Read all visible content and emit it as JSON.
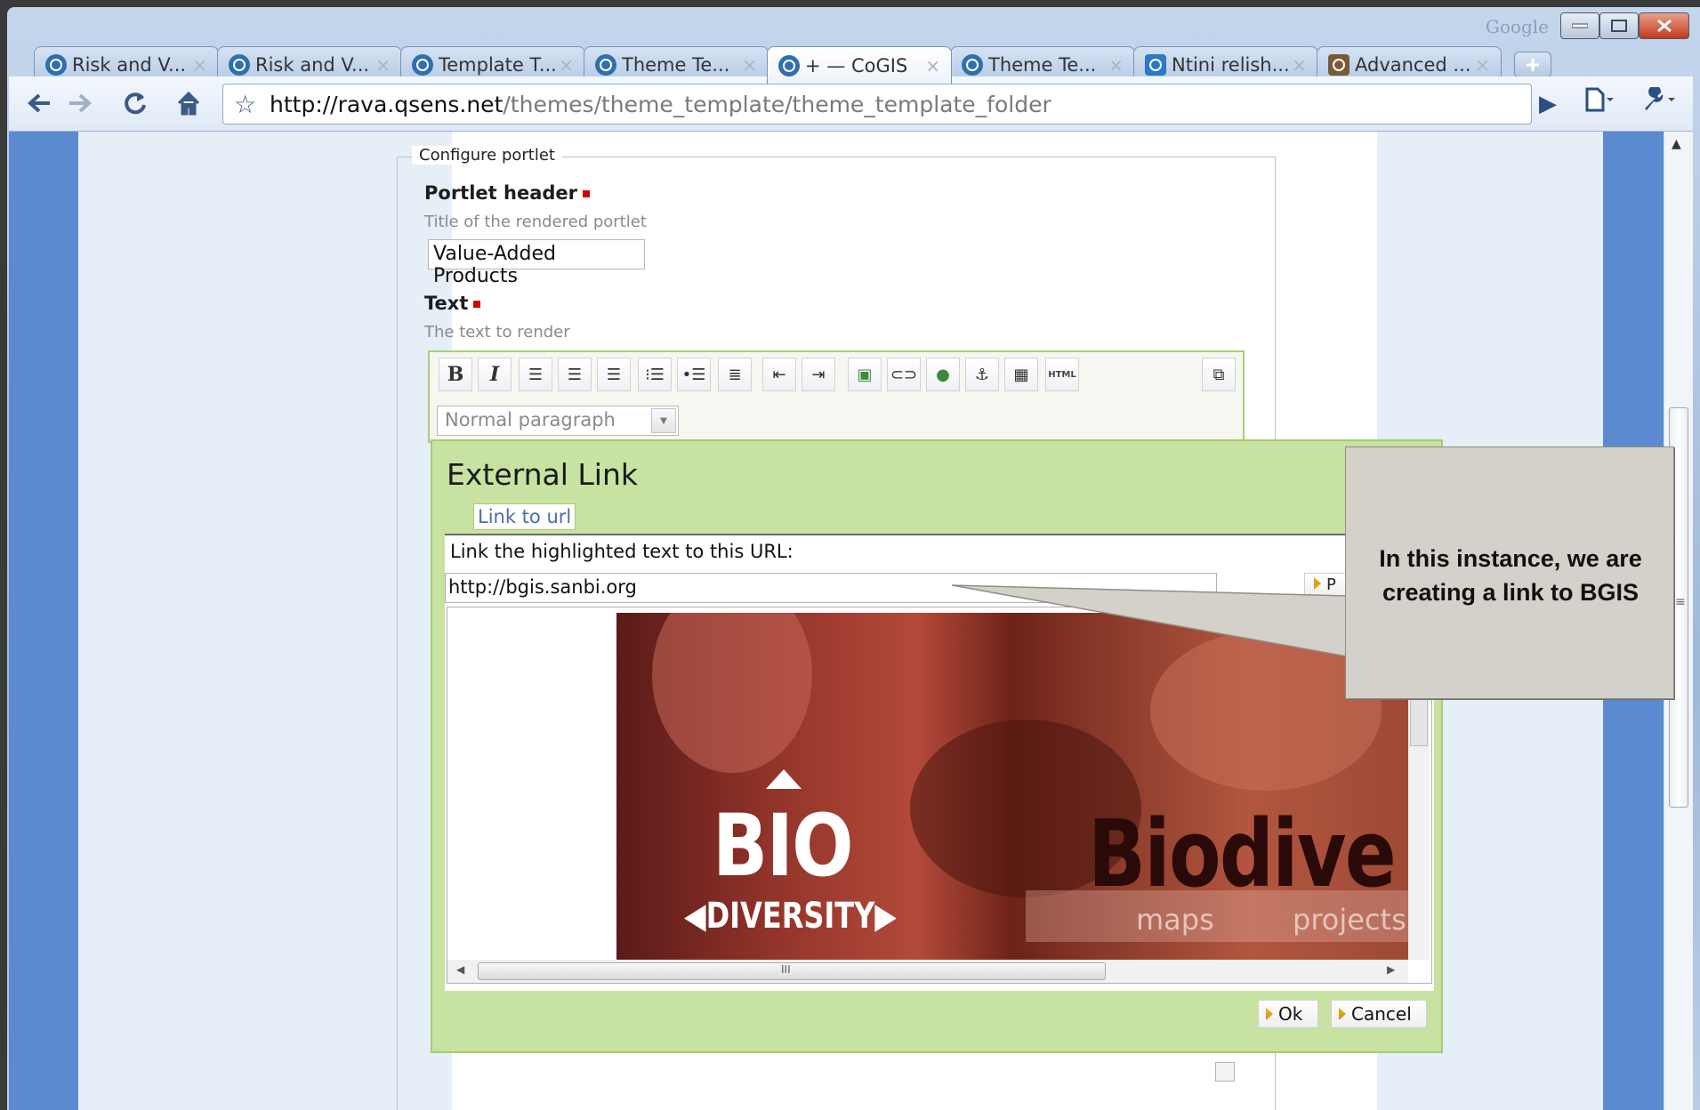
{
  "browser": {
    "google_label": "Google",
    "tabs": [
      {
        "label": "Risk and V...",
        "icon": "cogis-icon",
        "active": false
      },
      {
        "label": "Risk and V...",
        "icon": "cogis-icon",
        "active": false
      },
      {
        "label": "Template T...",
        "icon": "cogis-icon",
        "active": false
      },
      {
        "label": "Theme Te...",
        "icon": "cogis-icon",
        "active": false
      },
      {
        "label": "+ — CoGIS",
        "icon": "cogis-icon",
        "active": true
      },
      {
        "label": "Theme Te...",
        "icon": "cogis-icon",
        "active": false
      },
      {
        "label": "Ntini relish...",
        "icon": "google-icon",
        "active": false
      },
      {
        "label": "Advanced ...",
        "icon": "advanced-icon",
        "active": false
      }
    ],
    "tab_close_glyph": "×",
    "address": {
      "host": "http://rava.qsens.net",
      "path": "/themes/theme_template/theme_template_folder"
    }
  },
  "form": {
    "legend": "Configure portlet",
    "portlet_header": {
      "label": "Portlet header",
      "help": "Title of the rendered portlet",
      "value": "Value-Added Products"
    },
    "text": {
      "label": "Text",
      "help": "The text to render"
    },
    "editor": {
      "bold": "B",
      "italic": "I",
      "html": "HTML",
      "format_value": "Normal paragraph"
    }
  },
  "dialog": {
    "title": "External Link",
    "tab": "Link to url",
    "prompt": "Link the highlighted text to this URL:",
    "url_value": "http://bgis.sanbi.org",
    "preview_button_partial": "P",
    "preview": {
      "bio": "BIO",
      "diversity": "DIVERSITY",
      "biodive": "Biodive",
      "maps": "maps",
      "projects": "projects",
      "scroll_grip": "III"
    },
    "ok_label": "Ok",
    "cancel_label": "Cancel"
  },
  "callout": {
    "text": "In this instance, we are creating a link to BGIS"
  },
  "colors": {
    "accent_green": "#c8e2a2",
    "side_band_blue": "#5b8ad0",
    "required_red": "#d40000"
  }
}
